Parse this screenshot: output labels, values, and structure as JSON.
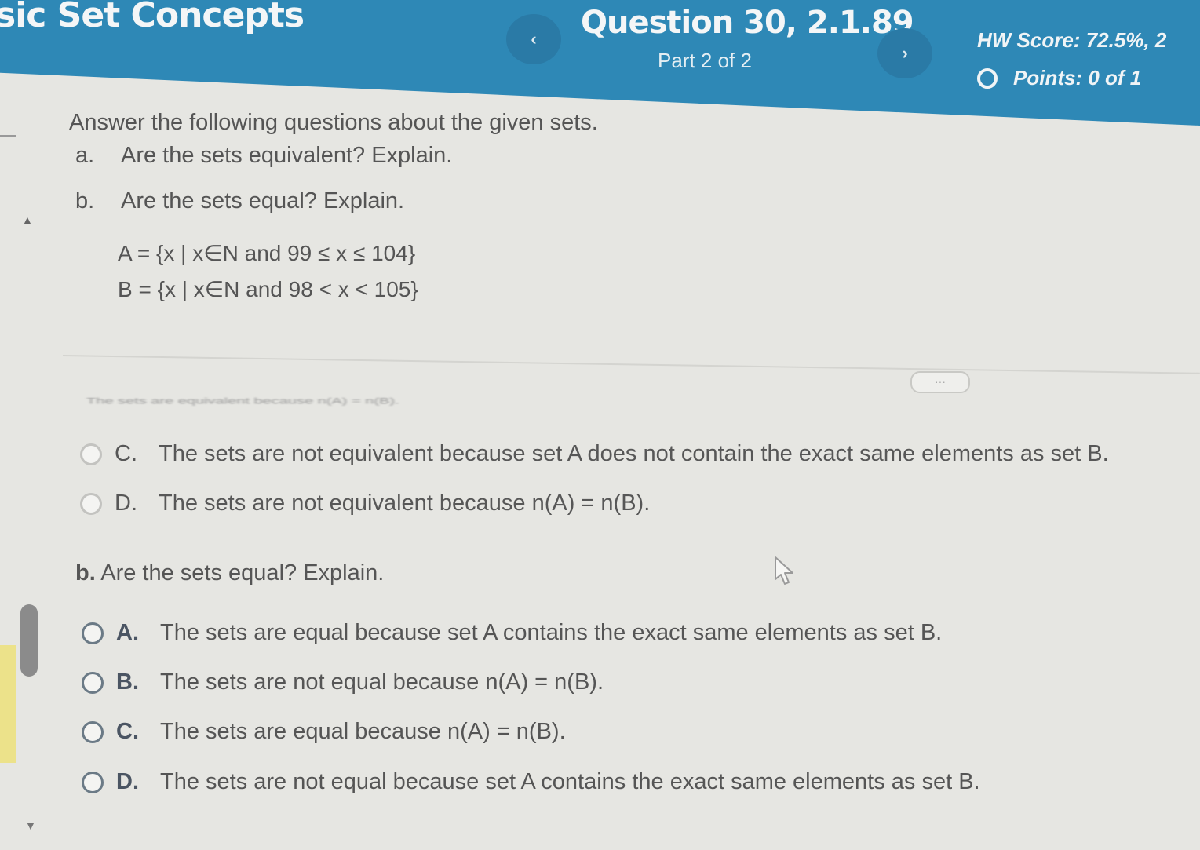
{
  "header": {
    "chapter_title": "sic Set Concepts",
    "question_title": "Question 30, 2.1.89",
    "part_label": "Part 2 of 2",
    "hw_score": "HW Score: 72.5%, 2",
    "points": "Points: 0 of 1",
    "prev_glyph": "‹",
    "next_glyph": "›"
  },
  "question": {
    "instruction": "Answer the following questions about the given sets.",
    "sub_a_tag": "a.",
    "sub_a_text": "Are the sets equivalent? Explain.",
    "sub_b_tag": "b.",
    "sub_b_text": "Are the sets equal? Explain.",
    "set_a": "A = {x | x∈N and 99 ≤ x ≤ 104}",
    "set_b": "B = {x | x∈N and 98 < x < 105}"
  },
  "more_button": "···",
  "part_a": {
    "cut_off_text": "The sets are equivalent because n(A) = n(B).",
    "options": [
      {
        "letter": "C.",
        "text": "The sets are not equivalent because set A does not contain the exact same elements as set B."
      },
      {
        "letter": "D.",
        "text": "The sets are not equivalent because n(A) = n(B)."
      }
    ]
  },
  "part_b": {
    "prompt_letter": "b.",
    "prompt_text": "Are the sets equal? Explain.",
    "options": [
      {
        "letter": "A.",
        "text": "The sets are equal because set A contains the exact same elements as set B."
      },
      {
        "letter": "B.",
        "text": "The sets are not equal because n(A) = n(B)."
      },
      {
        "letter": "C.",
        "text": "The sets are equal because n(A) = n(B)."
      },
      {
        "letter": "D.",
        "text": "The sets are not equal because set A contains the exact same elements as set B."
      }
    ]
  },
  "colors": {
    "header_bg": "#2e88b6",
    "page_bg": "#e6e6e2",
    "highlight_strip": "#ece28a"
  },
  "icons": {
    "prev": "chevron-left-icon",
    "next": "chevron-right-icon",
    "points": "circle-icon",
    "cursor": "mouse-pointer-icon"
  }
}
